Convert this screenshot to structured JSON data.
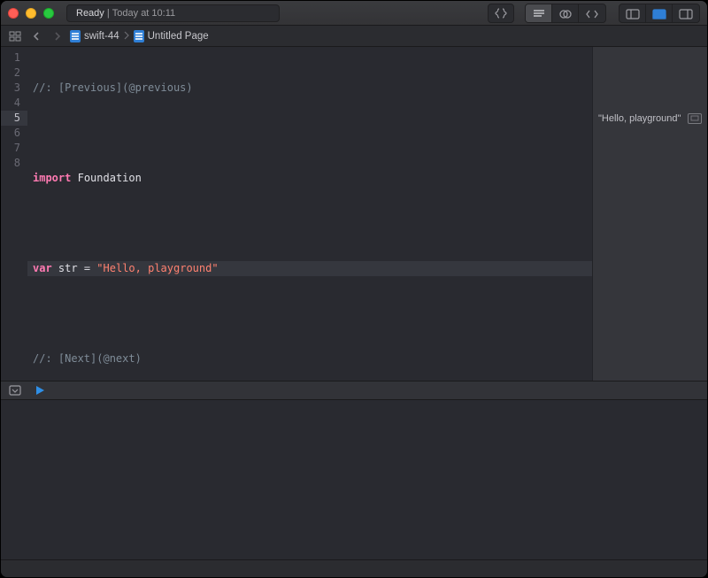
{
  "titlebar": {
    "status_prefix": "Ready",
    "status_time": "Today at 10:11"
  },
  "breadcrumb": {
    "project": "swift-44",
    "page": "Untitled Page"
  },
  "code": {
    "lines": [
      {
        "n": 1,
        "type": "comment",
        "text": "//: [Previous](@previous)"
      },
      {
        "n": 2,
        "type": "blank",
        "text": ""
      },
      {
        "n": 3,
        "type": "import",
        "kw": "import",
        "ident": "Foundation"
      },
      {
        "n": 4,
        "type": "blank",
        "text": ""
      },
      {
        "n": 5,
        "type": "decl",
        "kw": "var",
        "ident": "str",
        "eq": " = ",
        "str": "\"Hello, playground\"",
        "highlight": true
      },
      {
        "n": 6,
        "type": "blank",
        "text": ""
      },
      {
        "n": 7,
        "type": "comment",
        "text": "//: [Next](@next)"
      },
      {
        "n": 8,
        "type": "blank",
        "text": ""
      }
    ]
  },
  "results": {
    "line5": "\"Hello, playground\""
  }
}
